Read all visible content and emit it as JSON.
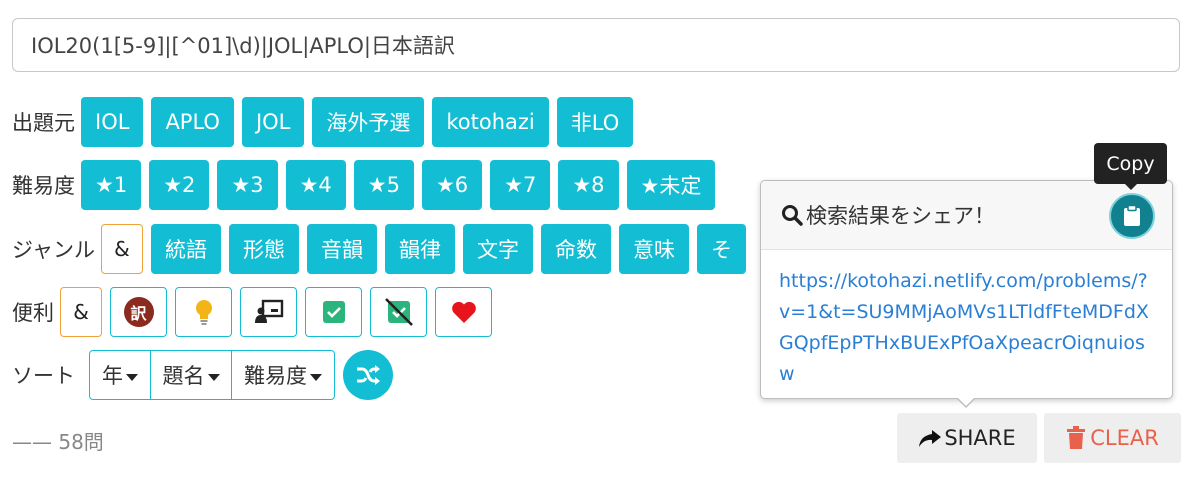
{
  "search": {
    "value": "IOL20(1[5-9]|[^01]\\d)|JOL|APLO|日本語訳"
  },
  "source": {
    "label": "出題元",
    "chips": [
      "IOL",
      "APLO",
      "JOL",
      "海外予選",
      "kotohazi",
      "非LO"
    ]
  },
  "difficulty": {
    "label": "難易度",
    "chips": [
      "★1",
      "★2",
      "★3",
      "★4",
      "★5",
      "★6",
      "★7",
      "★8",
      "★未定"
    ]
  },
  "genre": {
    "label": "ジャンル",
    "amp": "&",
    "chips": [
      "統語",
      "形態",
      "音韻",
      "韻律",
      "文字",
      "命数",
      "意味",
      "そ"
    ]
  },
  "convenience": {
    "label": "便利",
    "amp": "&",
    "icons": [
      "translation-icon",
      "lightbulb-icon",
      "presenter-icon",
      "checked-icon",
      "unchecked-icon",
      "heart-icon"
    ],
    "translation_glyph": "訳"
  },
  "sort": {
    "label": "ソート",
    "buttons": [
      "年",
      "題名",
      "難易度"
    ]
  },
  "result": {
    "count": "—— 58問"
  },
  "share": {
    "label": "SHARE"
  },
  "clear": {
    "label": "CLEAR"
  },
  "popover": {
    "title": "検索結果をシェア！",
    "url": "https://kotohazi.netlify.com/problems/?v=1&t=SU9MMjAoMVs1LTldfFteMDFdXGQpfEpPTHxBUExPfOaXpeacrOiqnuiosw",
    "tooltip": "Copy"
  },
  "colors": {
    "accent": "#13bed4",
    "amp_border": "#f0a236",
    "clear_text": "#e8614d",
    "link": "#2a7fd4",
    "copy_button": "#11808f"
  }
}
